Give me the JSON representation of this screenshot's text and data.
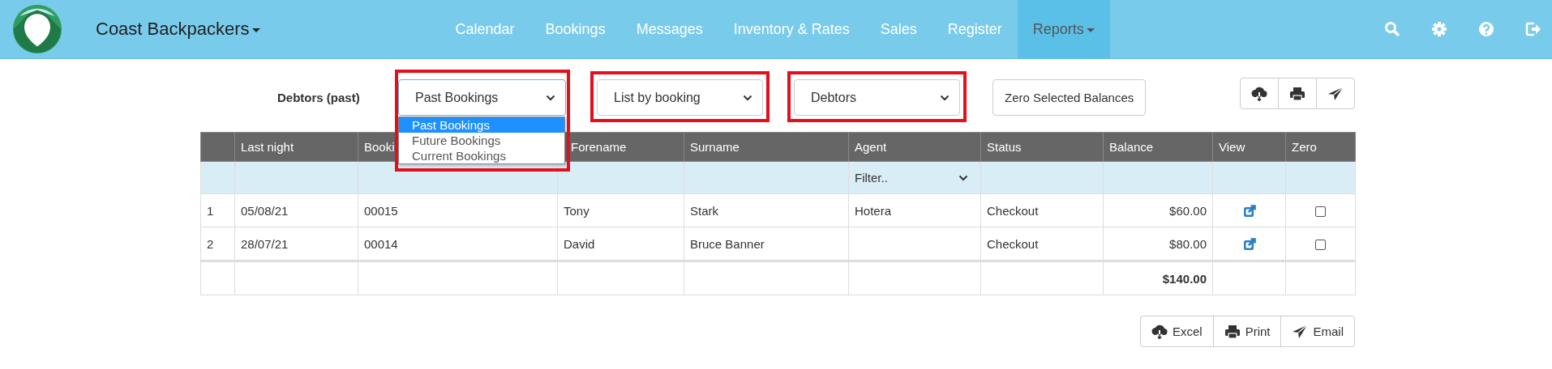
{
  "navbar": {
    "brand": "Coast Backpackers",
    "items": [
      {
        "label": "Calendar",
        "selected": false,
        "dropdown": false
      },
      {
        "label": "Bookings",
        "selected": false,
        "dropdown": false
      },
      {
        "label": "Messages",
        "selected": false,
        "dropdown": false
      },
      {
        "label": "Inventory & Rates",
        "selected": false,
        "dropdown": false
      },
      {
        "label": "Sales",
        "selected": false,
        "dropdown": false
      },
      {
        "label": "Register",
        "selected": false,
        "dropdown": false
      },
      {
        "label": "Reports",
        "selected": true,
        "dropdown": true
      }
    ]
  },
  "report_title": "Debtors (past)",
  "filters": [
    {
      "value": "Past Bookings",
      "highlighted": true,
      "expanded": true,
      "options": [
        {
          "label": "Past Bookings",
          "selected": true
        },
        {
          "label": "Future Bookings",
          "selected": false
        },
        {
          "label": "Current Bookings",
          "selected": false
        }
      ]
    },
    {
      "value": "List by booking",
      "highlighted": true,
      "expanded": false
    },
    {
      "value": "Debtors",
      "highlighted": true,
      "expanded": false
    }
  ],
  "zero_button": "Zero Selected Balances",
  "table": {
    "columns": [
      "",
      "Last night",
      "Booki",
      "Forename",
      "Surname",
      "Agent",
      "Status",
      "Balance",
      "View",
      "Zero"
    ],
    "agent_filter": {
      "placeholder": "Filter.."
    },
    "rows": [
      {
        "cells": [
          "1",
          "05/08/21",
          "00015",
          "Tony",
          "Stark",
          "Hotera",
          "Checkout",
          "$60.00"
        ],
        "zero_checked": false
      },
      {
        "cells": [
          "2",
          "28/07/21",
          "00014",
          "David",
          "Bruce Banner",
          "",
          "Checkout",
          "$80.00"
        ],
        "zero_checked": false
      }
    ],
    "total": "$140.00"
  },
  "export_buttons": [
    "Excel",
    "Print",
    "Email"
  ]
}
